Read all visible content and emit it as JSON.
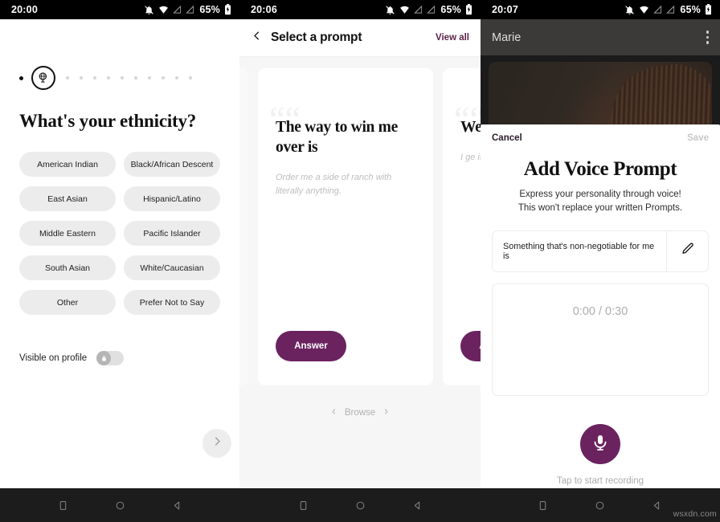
{
  "panels": [
    {
      "status_bar": {
        "time": "20:00",
        "battery_pct": "65%",
        "icons": [
          "bell-muted-icon",
          "wifi-icon",
          "signal-off-icon",
          "signal-off-icon",
          "battery-icon"
        ]
      },
      "progress": {
        "completed_dots": 1,
        "current_icon": "globe-icon",
        "remaining_dots": 10
      },
      "title": "What's your ethnicity?",
      "options": [
        "American Indian",
        "Black/African Descent",
        "East Asian",
        "Hispanic/Latino",
        "Middle Eastern",
        "Pacific Islander",
        "South Asian",
        "White/Caucasian",
        "Other",
        "Prefer Not to Say"
      ],
      "visibility": {
        "label": "Visible on profile",
        "state": "off",
        "icon": "lock-icon"
      },
      "next_button": {
        "icon": "chevron-right-icon"
      }
    },
    {
      "status_bar": {
        "time": "20:06",
        "battery_pct": "65%"
      },
      "header": {
        "back_icon": "chevron-left-icon",
        "title": "Select a prompt",
        "view_all": "View all"
      },
      "cards": [
        {
          "title": "",
          "sample": "",
          "answer_label": "",
          "ghost": true
        },
        {
          "title": "The way to win me over is",
          "sample": "Order me a side of ranch with literally anything.",
          "answer_label": "Answer",
          "ghost": false
        },
        {
          "title": "We'll get along if th",
          "sample": "I ge iter.",
          "answer_label": "Answer",
          "ghost": false
        }
      ],
      "browse": {
        "label": "Browse",
        "prev_icon": "chevron-left-icon",
        "next_icon": "chevron-right-icon"
      }
    },
    {
      "status_bar": {
        "time": "20:07",
        "battery_pct": "65%"
      },
      "appbar": {
        "title": "Marie",
        "menu_icon": "kebab-menu-icon"
      },
      "sheet": {
        "cancel_label": "Cancel",
        "save_label": "Save",
        "title": "Add Voice Prompt",
        "subtitle_line1": "Express your personality through voice!",
        "subtitle_line2": "This won't replace your written Prompts.",
        "prompt_value": "Something that's non-negotiable for me is",
        "edit_icon": "pencil-icon",
        "timer": "0:00 / 0:30",
        "mic_icon": "microphone-icon",
        "hint": "Tap to start recording"
      }
    }
  ],
  "nav_bar": {
    "buttons": [
      "square-icon",
      "circle-icon",
      "triangle-back-icon"
    ]
  },
  "watermark": "wsxdn.com",
  "colors": {
    "accent_purple": "#6b2360",
    "link_purple": "#5c2246",
    "chip_gray": "#ececec"
  }
}
